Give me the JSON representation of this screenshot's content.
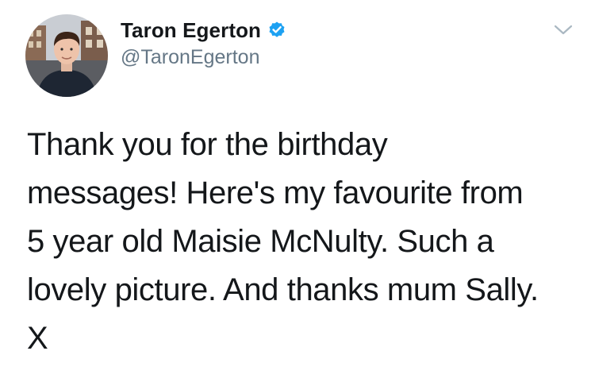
{
  "author": {
    "display_name": "Taron Egerton",
    "handle": "@TaronEgerton",
    "verified": true,
    "avatar_icon": "profile-photo"
  },
  "tweet": {
    "text": "Thank you for the birthday\nmessages! Here's my favourite from\n5 year old Maisie McNulty. Such a\nlovely picture. And thanks mum Sally.\nX"
  },
  "icons": {
    "verified": "verified-badge-icon",
    "menu": "chevron-down-icon"
  },
  "colors": {
    "name_text": "#14171a",
    "handle_text": "#657786",
    "verified_blue": "#1da1f2",
    "caret_gray": "#aab8c2"
  }
}
